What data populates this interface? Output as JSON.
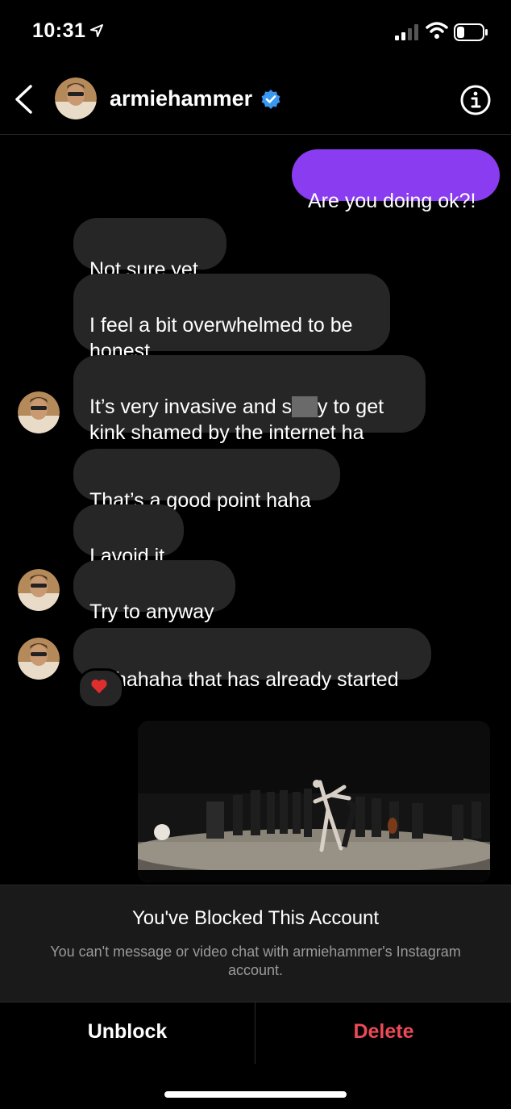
{
  "status_bar": {
    "time": "10:31"
  },
  "header": {
    "username": "armiehammer"
  },
  "messages": [
    {
      "from": "me",
      "text": "Are you doing ok?!"
    },
    {
      "from": "them",
      "text": "Not sure yet."
    },
    {
      "from": "them",
      "text": "I feel a bit overwhelmed to be\nhonest"
    },
    {
      "from": "them",
      "text_before": "It’s very invasive and s",
      "text_after": "y to get\nkink shamed by the internet ha"
    },
    {
      "from": "them",
      "text": "That’s a good point haha"
    },
    {
      "from": "them",
      "text": "I avoid it"
    },
    {
      "from": "them",
      "text": "Try to anyway"
    },
    {
      "from": "them",
      "text": "Hahahaha that has already started",
      "reaction": "heart"
    }
  ],
  "blocked_panel": {
    "title": "You've Blocked This Account",
    "subtitle": "You can't message or video chat with armiehammer's Instagram account."
  },
  "actions": {
    "unblock": "Unblock",
    "delete": "Delete"
  },
  "colors": {
    "outgoing_bubble": "#8a3cf0",
    "incoming_bubble": "#262626",
    "delete": "#ed4956",
    "verified": "#3897f0"
  }
}
